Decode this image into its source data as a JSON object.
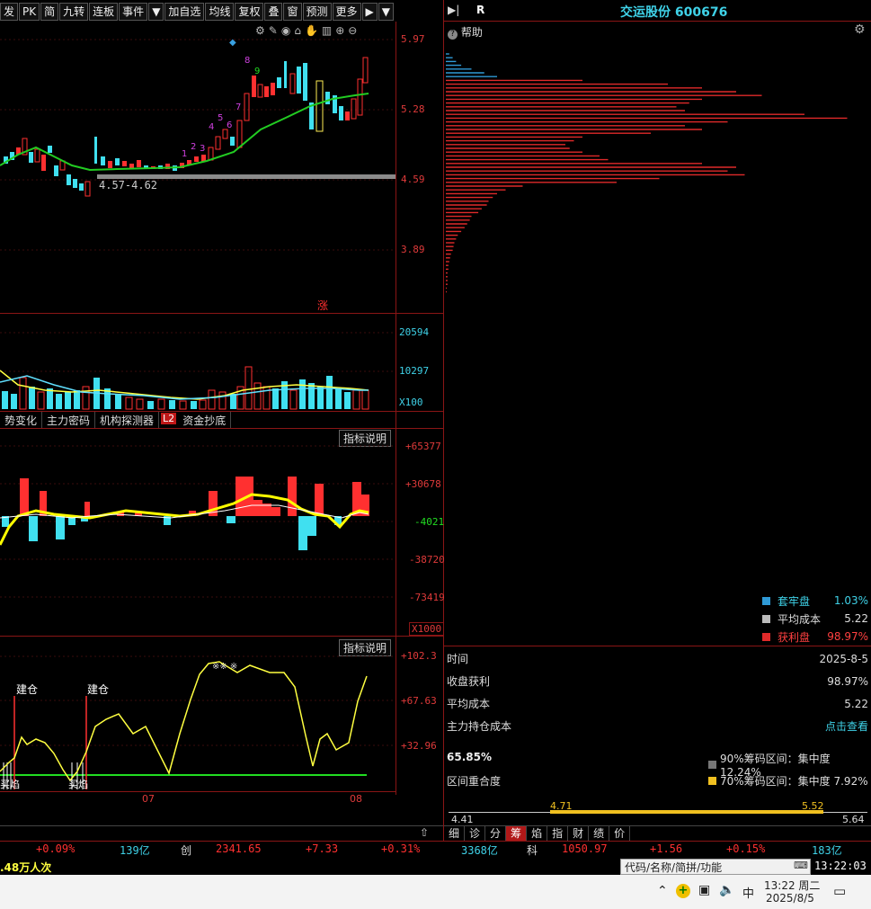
{
  "toolbar": [
    "发",
    "PK",
    "简",
    "九转",
    "连板",
    "事件",
    "▼",
    "加自选",
    "均线",
    "复权",
    "叠",
    "窗",
    "预测",
    "更多",
    "▶",
    "▼"
  ],
  "price_axis": [
    "5.97",
    "5.28",
    "4.59",
    "3.89"
  ],
  "range_label": "4.57-4.62",
  "zhang_badge": "涨",
  "seq_numbers": [
    "1",
    "2",
    "3",
    "4",
    "5",
    "6",
    "7",
    "8",
    "9"
  ],
  "vol_axis": [
    "20594",
    "10297",
    "X100"
  ],
  "tabs": [
    "势变化",
    "主力密码",
    "机构探测器",
    "L2",
    "资金抄底"
  ],
  "indicator_btn": "指标说明",
  "mid_axis": [
    "+65377",
    "+30678",
    "-4021",
    "-38720",
    "-73419",
    "X1000"
  ],
  "low_axis": [
    "+102.3",
    "+67.63",
    "+32.96"
  ],
  "jiancang": [
    "建仓",
    "建仓"
  ],
  "low_marks": [
    "买焰",
    "买焰"
  ],
  "month_labels": [
    "07",
    "08"
  ],
  "right_header": {
    "arrow": "▶|",
    "r": "R",
    "title": "交运股份 600676",
    "help": "帮助"
  },
  "legend": [
    {
      "label": "套牢盘",
      "value": "1.03%",
      "color": "#2f9ad6",
      "vcolor": "#3fd2e8"
    },
    {
      "label": "平均成本",
      "value": "5.22",
      "color": "#bbbbbb",
      "vcolor": "#dddddd"
    },
    {
      "label": "获利盘",
      "value": "98.97%",
      "color": "#e02a2a",
      "vcolor": "#ff4040"
    }
  ],
  "info": [
    {
      "k": "时间",
      "v": "2025-8-5"
    },
    {
      "k": "收盘获利",
      "v": "98.97%"
    },
    {
      "k": "平均成本",
      "v": "5.22"
    },
    {
      "k": "主力持仓成本",
      "v": "点击查看"
    }
  ],
  "concentration": {
    "pct": "65.85%",
    "overlap": "区间重合度",
    "r90": "90%筹码区间：集中度12.24%",
    "r70": "70%筹码区间：集中度 7.92%"
  },
  "range_scale": {
    "a": "4.71",
    "b": "5.52",
    "lo": "4.41",
    "hi": "5.64"
  },
  "bottom_tabs": [
    "细",
    "诊",
    "分",
    "筹",
    "焰",
    "指",
    "财",
    "绩",
    "价"
  ],
  "ticker": [
    "+0.09%",
    "139亿",
    "创",
    "2341.65",
    "+7.33",
    "+0.31%",
    "3368亿",
    "科",
    "1050.97",
    "+1.56",
    "+0.15%",
    "183亿"
  ],
  "status": {
    "left": ".48万人次",
    "search": "代码/名称/简拼/功能",
    "time": "13:22:03"
  },
  "taskbar": {
    "ime": "中",
    "time": "13:22 周二",
    "date": "2025/8/5"
  }
}
